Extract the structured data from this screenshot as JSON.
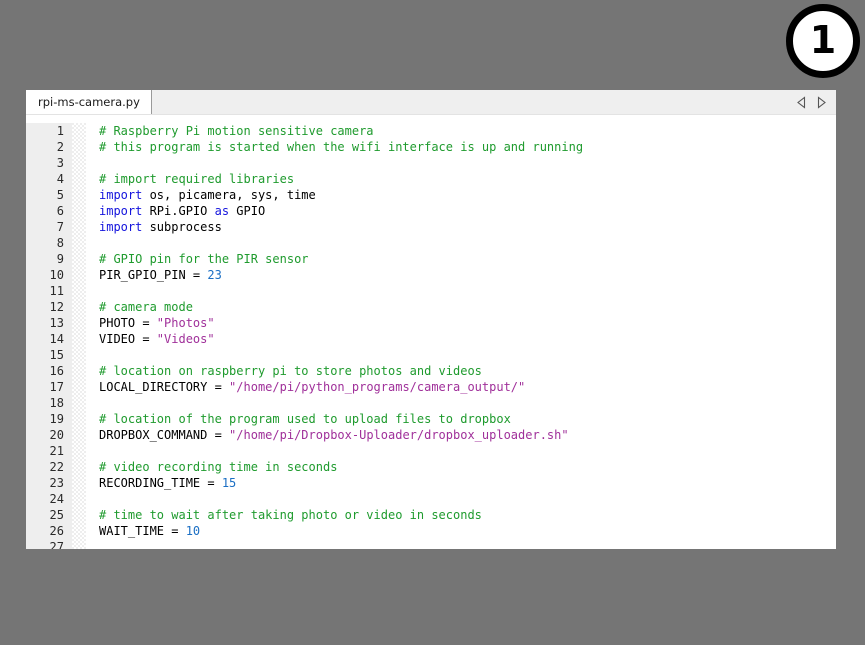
{
  "badge": {
    "number": "1",
    "name": "step-number-badge"
  },
  "editor": {
    "tab": {
      "filename": "rpi-ms-camera.py"
    },
    "nav": {
      "prev_icon": "triangle-left-icon",
      "next_icon": "triangle-right-icon"
    },
    "line_numbers": [
      "1",
      "2",
      "3",
      "4",
      "5",
      "6",
      "7",
      "8",
      "9",
      "10",
      "11",
      "12",
      "13",
      "14",
      "15",
      "16",
      "17",
      "18",
      "19",
      "20",
      "21",
      "22",
      "23",
      "24",
      "25",
      "26",
      "27"
    ],
    "code_lines": [
      {
        "n": "1",
        "text": "# Raspberry Pi motion sensitive camera",
        "tokens": [
          {
            "t": "# Raspberry Pi motion sensitive camera",
            "c": "com"
          }
        ]
      },
      {
        "n": "2",
        "text": "# this program is started when the wifi interface is up and running",
        "tokens": [
          {
            "t": "# this program is started when the wifi interface is up and running",
            "c": "com"
          }
        ]
      },
      {
        "n": "3",
        "text": "",
        "tokens": []
      },
      {
        "n": "4",
        "text": "# import required libraries",
        "tokens": [
          {
            "t": "# import required libraries",
            "c": "com"
          }
        ]
      },
      {
        "n": "5",
        "text": "import os, picamera, sys, time",
        "tokens": [
          {
            "t": "import",
            "c": "kw"
          },
          {
            "t": " os, picamera, sys, time",
            "c": "txt"
          }
        ]
      },
      {
        "n": "6",
        "text": "import RPi.GPIO as GPIO",
        "tokens": [
          {
            "t": "import",
            "c": "kw"
          },
          {
            "t": " RPi.GPIO ",
            "c": "txt"
          },
          {
            "t": "as",
            "c": "kw"
          },
          {
            "t": " GPIO",
            "c": "txt"
          }
        ]
      },
      {
        "n": "7",
        "text": "import subprocess",
        "tokens": [
          {
            "t": "import",
            "c": "kw"
          },
          {
            "t": " subprocess",
            "c": "txt"
          }
        ]
      },
      {
        "n": "8",
        "text": "",
        "tokens": []
      },
      {
        "n": "9",
        "text": "# GPIO pin for the PIR sensor",
        "tokens": [
          {
            "t": "# GPIO pin for the PIR sensor",
            "c": "com"
          }
        ]
      },
      {
        "n": "10",
        "text": "PIR_GPIO_PIN = 23",
        "tokens": [
          {
            "t": "PIR_GPIO_PIN = ",
            "c": "txt"
          },
          {
            "t": "23",
            "c": "num"
          }
        ]
      },
      {
        "n": "11",
        "text": "",
        "tokens": []
      },
      {
        "n": "12",
        "text": "# camera mode",
        "tokens": [
          {
            "t": "# camera mode",
            "c": "com"
          }
        ]
      },
      {
        "n": "13",
        "text": "PHOTO = \"Photos\"",
        "tokens": [
          {
            "t": "PHOTO = ",
            "c": "txt"
          },
          {
            "t": "\"Photos\"",
            "c": "str"
          }
        ]
      },
      {
        "n": "14",
        "text": "VIDEO = \"Videos\"",
        "tokens": [
          {
            "t": "VIDEO = ",
            "c": "txt"
          },
          {
            "t": "\"Videos\"",
            "c": "str"
          }
        ]
      },
      {
        "n": "15",
        "text": "",
        "tokens": []
      },
      {
        "n": "16",
        "text": "# location on raspberry pi to store photos and videos",
        "tokens": [
          {
            "t": "# location on raspberry pi to store photos and videos",
            "c": "com"
          }
        ]
      },
      {
        "n": "17",
        "text": "LOCAL_DIRECTORY = \"/home/pi/python_programs/camera_output/\"",
        "tokens": [
          {
            "t": "LOCAL_DIRECTORY = ",
            "c": "txt"
          },
          {
            "t": "\"/home/pi/python_programs/camera_output/\"",
            "c": "str"
          }
        ]
      },
      {
        "n": "18",
        "text": "",
        "tokens": []
      },
      {
        "n": "19",
        "text": "# location of the program used to upload files to dropbox",
        "tokens": [
          {
            "t": "# location of the program used to upload files to dropbox",
            "c": "com"
          }
        ]
      },
      {
        "n": "20",
        "text": "DROPBOX_COMMAND = \"/home/pi/Dropbox-Uploader/dropbox_uploader.sh\"",
        "tokens": [
          {
            "t": "DROPBOX_COMMAND = ",
            "c": "txt"
          },
          {
            "t": "\"/home/pi/Dropbox-Uploader/dropbox_uploader.sh\"",
            "c": "str"
          }
        ]
      },
      {
        "n": "21",
        "text": "",
        "tokens": []
      },
      {
        "n": "22",
        "text": "# video recording time in seconds",
        "tokens": [
          {
            "t": "# video recording time in seconds",
            "c": "com"
          }
        ]
      },
      {
        "n": "23",
        "text": "RECORDING_TIME = 15",
        "tokens": [
          {
            "t": "RECORDING_TIME = ",
            "c": "txt"
          },
          {
            "t": "15",
            "c": "num"
          }
        ]
      },
      {
        "n": "24",
        "text": "",
        "tokens": []
      },
      {
        "n": "25",
        "text": "# time to wait after taking photo or video in seconds",
        "tokens": [
          {
            "t": "# time to wait after taking photo or video in seconds",
            "c": "com"
          }
        ]
      },
      {
        "n": "26",
        "text": "WAIT_TIME = 10",
        "tokens": [
          {
            "t": "WAIT_TIME = ",
            "c": "txt"
          },
          {
            "t": "10",
            "c": "num"
          }
        ]
      },
      {
        "n": "27",
        "text": "",
        "tokens": []
      }
    ]
  },
  "colors": {
    "page_background": "#757575",
    "editor_background": "#ffffff",
    "tabbar_background": "#efefef",
    "gutter_background": "#eeeeee",
    "comment": "#1f9b2e",
    "keyword": "#1414dd",
    "string": "#a0309a",
    "number": "#1b6fc4",
    "text": "#000000"
  }
}
